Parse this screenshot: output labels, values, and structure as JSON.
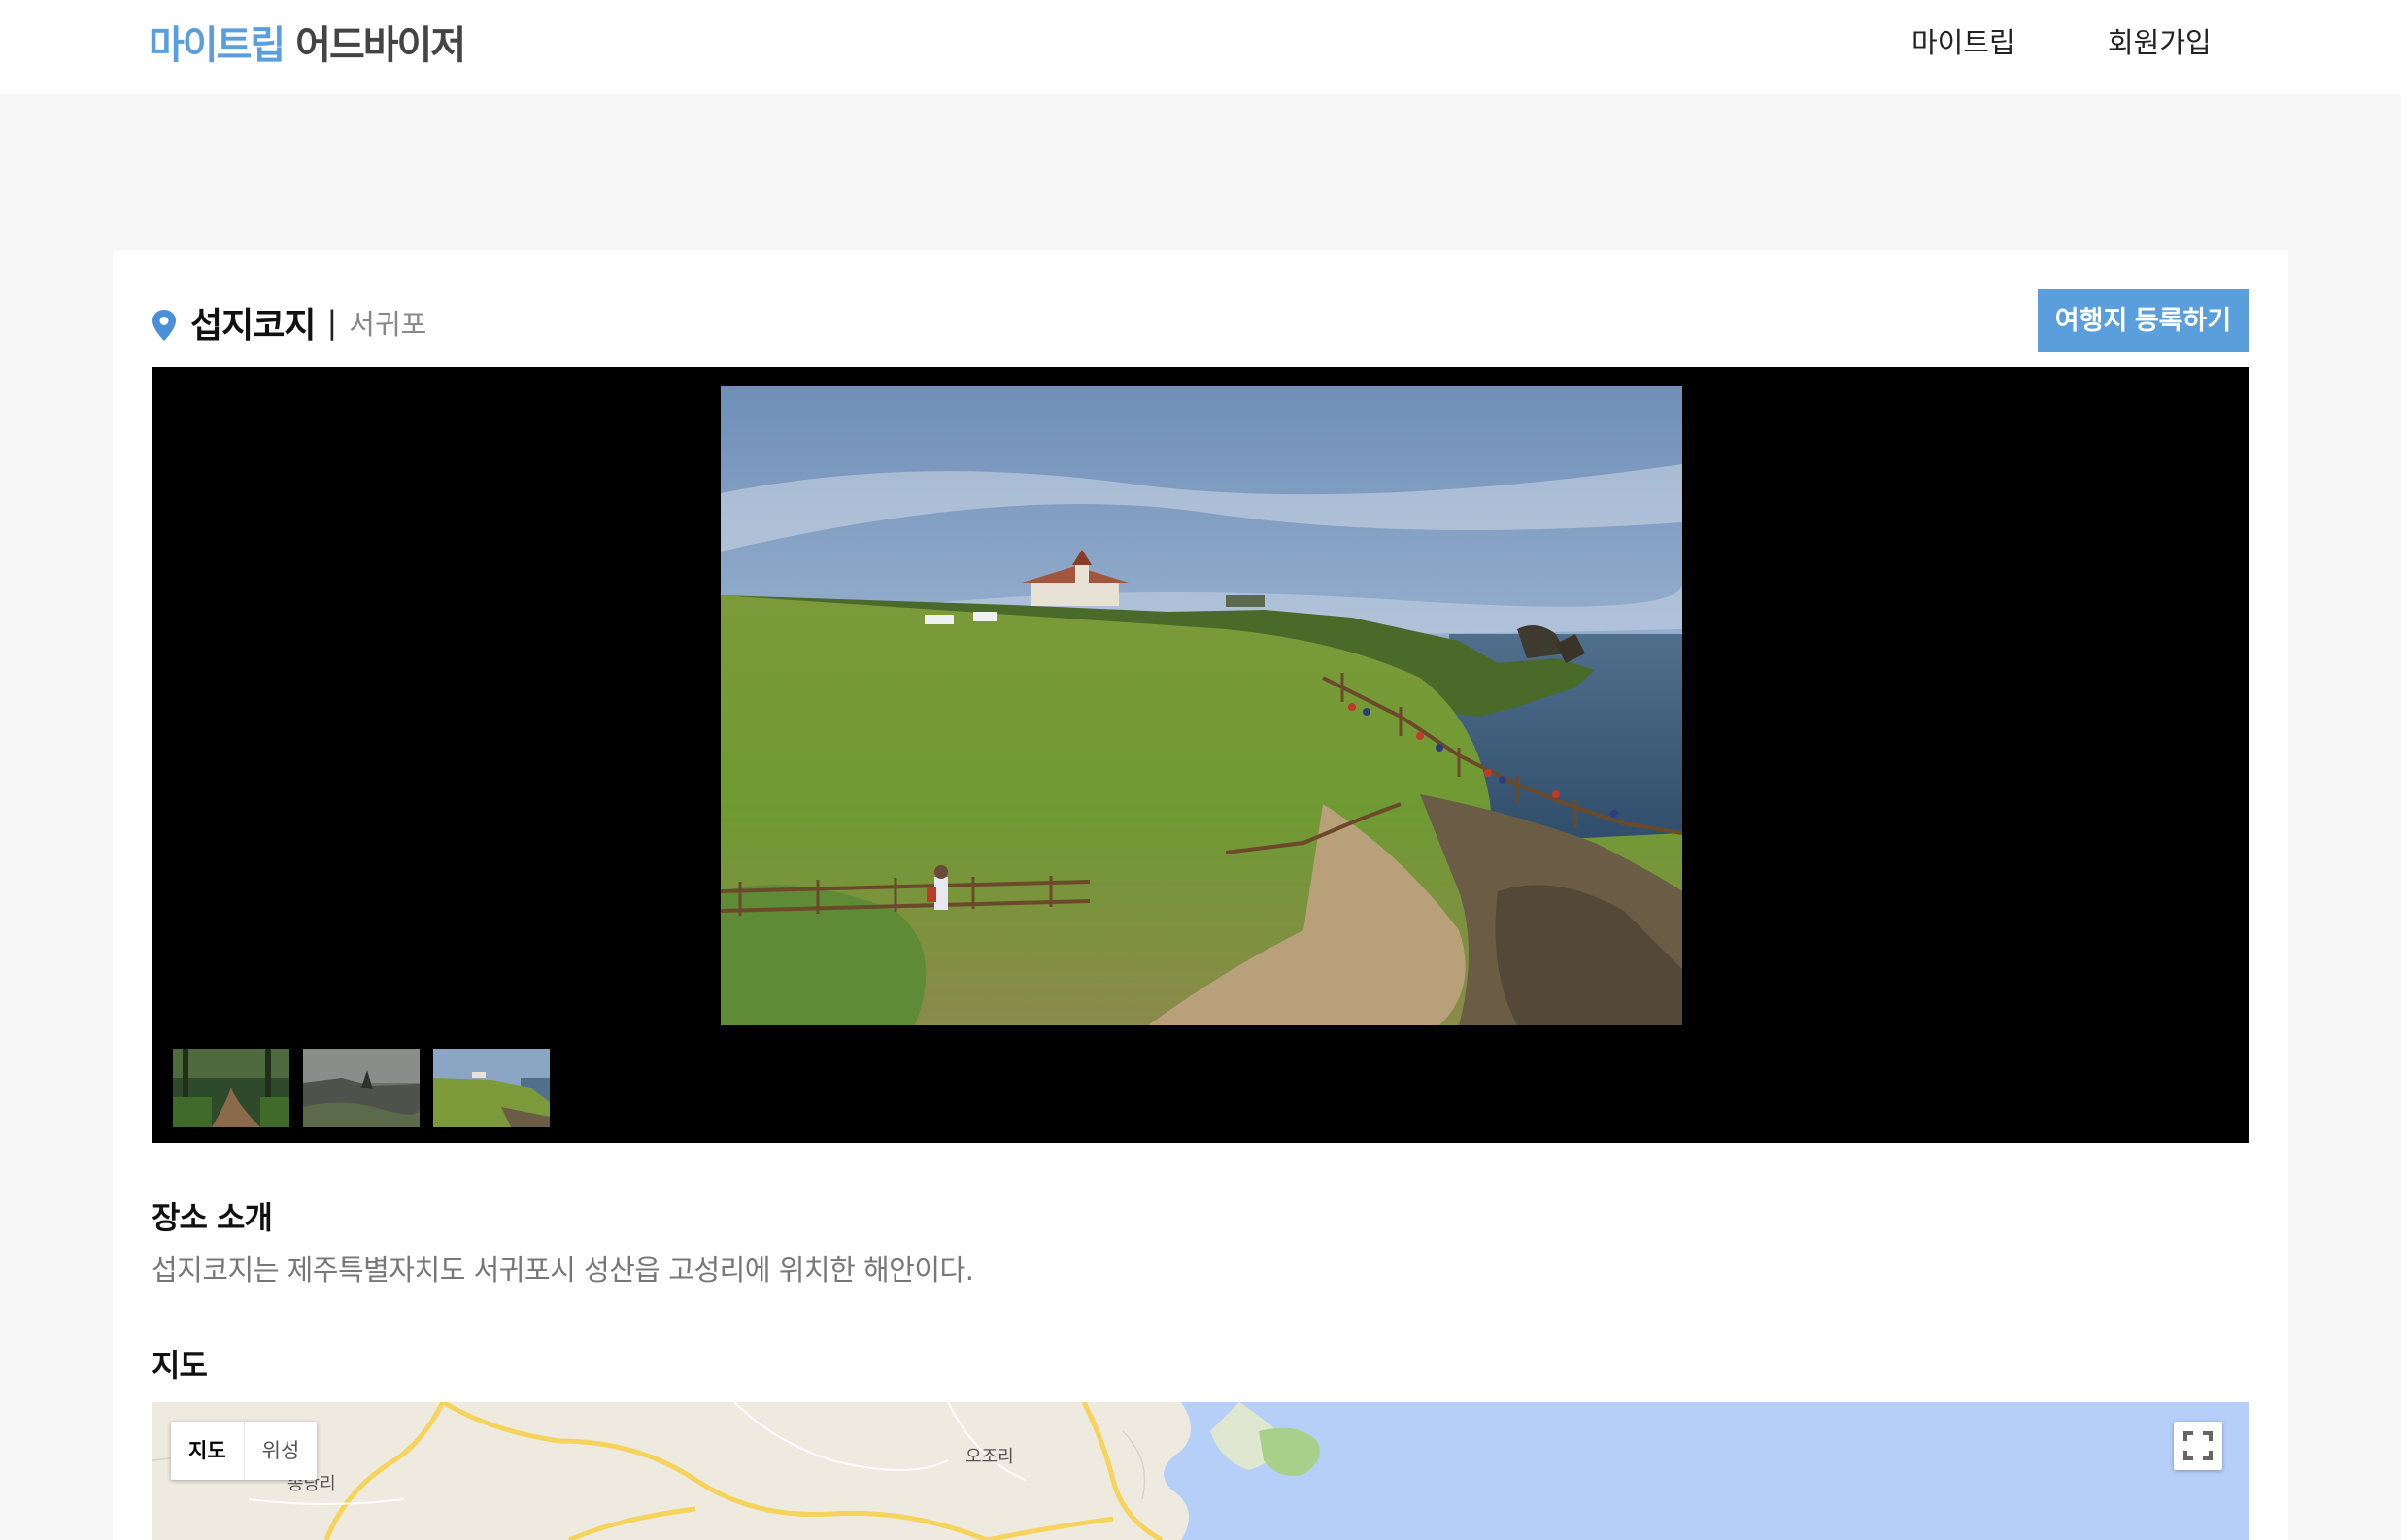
{
  "header": {
    "logo_brand": "마이트립",
    "logo_rest": "어드바이저",
    "nav": {
      "mytrip": "마이트립",
      "signup": "회원가입"
    }
  },
  "place": {
    "name": "섭지코지",
    "separator": "|",
    "region": "서귀포",
    "register_button": "여행지 등록하기"
  },
  "gallery": {
    "main_photo": "coastal-meadow-photo",
    "thumbnails": [
      "forest-path-photo",
      "misty-coast-photo",
      "coastal-meadow-photo"
    ]
  },
  "intro": {
    "title": "장소 소개",
    "text": "섭지코지는 제주특별자치도 서귀포시 성산읍 고성리에 위치한 해안이다."
  },
  "map": {
    "title": "지도",
    "toggle_map": "지도",
    "toggle_satellite": "위성",
    "labels": {
      "village_a": "송당리",
      "village_b": "오조리"
    },
    "colors": {
      "land": "#eeeae0",
      "water": "#b6cff8",
      "road": "#f6d35b"
    }
  },
  "colors": {
    "accent": "#5a9fdc",
    "page_bg": "#f5f6f5"
  }
}
